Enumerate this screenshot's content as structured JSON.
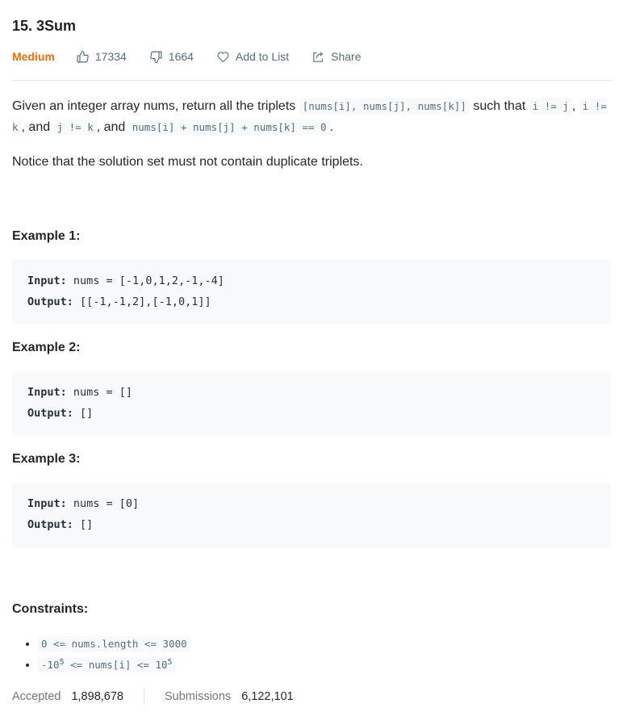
{
  "problem": {
    "title": "15. 3Sum",
    "difficulty": "Medium",
    "likes": "17334",
    "dislikes": "1664",
    "add_to_list": "Add to List",
    "share": "Share"
  },
  "description": {
    "p1_a": "Given an integer array nums, return all the triplets ",
    "p1_code1": "[nums[i], nums[j], nums[k]]",
    "p1_b": " such that ",
    "p1_code2": "i != j",
    "p1_c": ", ",
    "p1_code3": "i != k",
    "p1_d": ", and ",
    "p1_code4": "j != k",
    "p1_e": ", and ",
    "p1_code5": "nums[i] + nums[j] + nums[k] == 0",
    "p1_f": ".",
    "p2": "Notice that the solution set must not contain duplicate triplets."
  },
  "examples": [
    {
      "title": "Example 1:",
      "input_label": "Input:",
      "input": " nums = [-1,0,1,2,-1,-4]",
      "output_label": "Output:",
      "output": " [[-1,-1,2],[-1,0,1]]"
    },
    {
      "title": "Example 2:",
      "input_label": "Input:",
      "input": " nums = []",
      "output_label": "Output:",
      "output": " []"
    },
    {
      "title": "Example 3:",
      "input_label": "Input:",
      "input": " nums = [0]",
      "output_label": "Output:",
      "output": " []"
    }
  ],
  "constraints": {
    "title": "Constraints:",
    "c1": "0 <= nums.length <= 3000",
    "c2_a": "-10",
    "c2_sup1": "5",
    "c2_b": " <= nums[i] <= 10",
    "c2_sup2": "5"
  },
  "stats": {
    "accepted_label": "Accepted",
    "accepted_value": "1,898,678",
    "submissions_label": "Submissions",
    "submissions_value": "6,122,101"
  }
}
